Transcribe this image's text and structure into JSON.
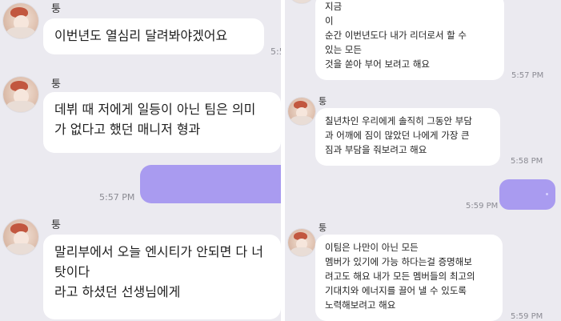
{
  "left_chat": {
    "messages": [
      {
        "sender": "퉁",
        "text": "이번년도 열심리 달려봐야겠어요",
        "time": "5:5"
      },
      {
        "sender": "퉁",
        "text": "데뷔 때 저에게 일등이 아닌 팀은 의미\n가 없다고 했던 매니저 형과"
      },
      {
        "outgoing": true,
        "text": "",
        "time": "5:57 PM"
      },
      {
        "sender": "퉁",
        "text": "말리부에서 오늘 엔시티가 안되면 다 너\n탓이다\n라고 하셨던 선생님에게"
      }
    ]
  },
  "right_chat": {
    "messages": [
      {
        "text": "지금\n이\n순간 이번년도다 내가 리더로서 할 수\n있는 모든\n것을 쏟아 부어 보려고 해요",
        "time": "5:57 PM"
      },
      {
        "sender": "퉁",
        "text": "칠년차인 우리에게 솔직히 그동안 부담\n과 어깨에 짐이 많았던 나에게 가장 큰\n짐과 부담을 줘보려고 해요",
        "time": "5:58 PM"
      },
      {
        "outgoing": true,
        "text": "",
        "time": "5:59 PM"
      },
      {
        "sender": "퉁",
        "text": "이팀은 나만이 아닌 모든\n멤버가 있기에 가능 하다는걸 증명해보\n려고도 해요 내가 모든 멤버들의 최고의\n기대치와 에너지를 끌어 낼 수 있도록\n노력해보려고 해요",
        "time": "5:59 PM"
      }
    ]
  }
}
